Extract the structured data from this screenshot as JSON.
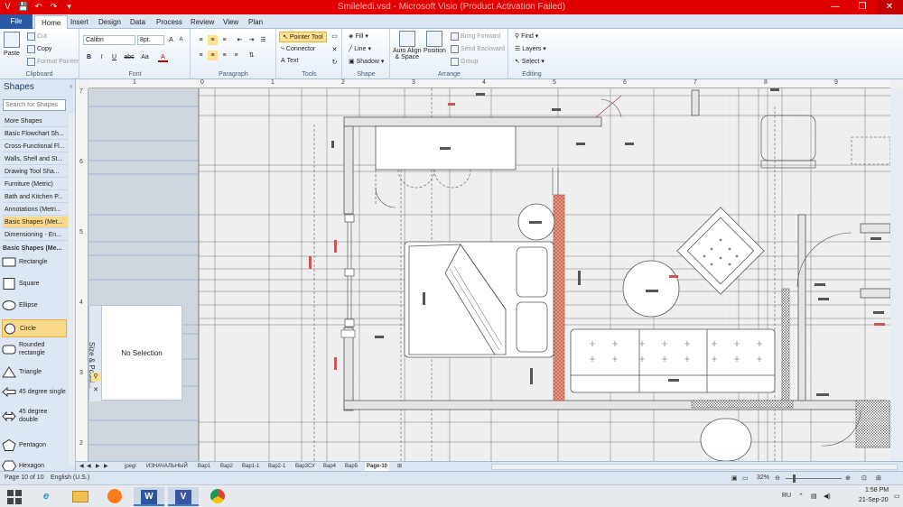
{
  "window": {
    "title": "Smileledi.vsd - Microsoft Visio (Product Activation Failed)",
    "minimize_glyph": "—",
    "restore_glyph": "❐",
    "close_glyph": "✕"
  },
  "quick_access": {
    "visio_icon": "V",
    "save_icon": "💾",
    "undo_icon": "↶",
    "redo_icon": "↷",
    "customize_icon": "▾"
  },
  "ribbon_tabs": [
    "File",
    "Home",
    "Insert",
    "Design",
    "Data",
    "Process",
    "Review",
    "View",
    "Plan"
  ],
  "ribbon": {
    "clipboard": {
      "label": "Clipboard",
      "paste": "Paste",
      "cut": "Cut",
      "copy": "Copy",
      "format_painter": "Format Painter"
    },
    "font": {
      "label": "Font",
      "family": "Calibri",
      "size": "8pt.",
      "bold": "B",
      "italic": "I",
      "underline": "U",
      "strike": "abc",
      "case": "Aa",
      "font_color": "A"
    },
    "paragraph": {
      "label": "Paragraph"
    },
    "tools": {
      "label": "Tools",
      "pointer": "Pointer Tool",
      "connector": "Connector",
      "text": "Text"
    },
    "shape": {
      "label": "Shape",
      "fill": "Fill",
      "line": "Line",
      "shadow": "Shadow"
    },
    "arrange": {
      "label": "Arrange",
      "auto_align_1": "Auto Align",
      "auto_align_2": "& Space",
      "position": "Position",
      "bring_forward": "Bring Forward",
      "send_backward": "Send Backward",
      "group": "Group"
    },
    "editing": {
      "label": "Editing",
      "find": "Find",
      "layers": "Layers",
      "select": "Select"
    }
  },
  "shapes_panel": {
    "title": "Shapes",
    "search_placeholder": "Search for Shapes",
    "stencils": [
      "More Shapes",
      "Basic Flowchart Sh...",
      "Cross-Functional Fl...",
      "Walls, Shell and St...",
      "Drawing Tool Sha...",
      "Furniture (Metric)",
      "Bath and Kitchen P...",
      "Annotations (Metri...",
      "Basic Shapes (Met...",
      "Dimensioning - En..."
    ],
    "open_stencil": "Basic Shapes (Me...",
    "masters": [
      "Rectangle",
      "Square",
      "Ellipse",
      "Circle",
      "Rounded rectangle",
      "Triangle",
      "45 degree single",
      "45 degree double",
      "Pentagon",
      "Hexagon"
    ]
  },
  "size_position": {
    "title": "Size & Positi...",
    "empty": "No Selection"
  },
  "ruler": {
    "h": [
      "1",
      "0",
      "1",
      "2",
      "3",
      "4",
      "5",
      "6",
      "7",
      "8",
      "9"
    ],
    "v": [
      "7",
      "6",
      "5",
      "4",
      "3",
      "2"
    ]
  },
  "page_tabs": [
    "jpegi",
    "ИЗНАЧАЛЬНЫЙ",
    "Вар1",
    "Вар2",
    "Вар1-1",
    "Вар2-1",
    "Вар3СУ",
    "Вар4",
    "Вар5",
    "Page-10"
  ],
  "active_page_tab": "Page-10",
  "status": {
    "page": "Page 10 of 10",
    "language": "English (U.S.)",
    "zoom": "32%"
  },
  "taskbar": {
    "apps": [
      "start",
      "ie",
      "explorer",
      "firefox",
      "word",
      "visio",
      "chrome"
    ],
    "language": "RU",
    "time": "1:58 PM",
    "date": "21-Sep-20"
  },
  "colors": {
    "title_bg": "#e00000",
    "accent": "#2a5aa3",
    "selected": "#fbd98a"
  }
}
